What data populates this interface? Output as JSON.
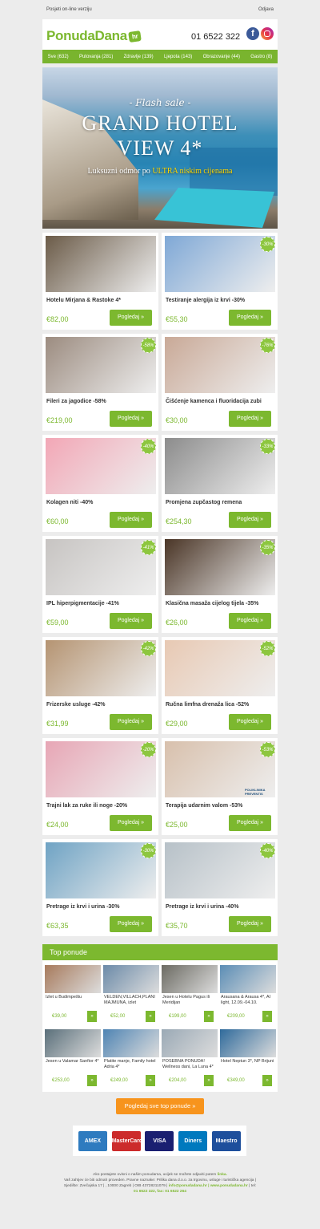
{
  "preheader": {
    "online": "Posjeti on-line verziju",
    "unsubscribe": "Odjava"
  },
  "header": {
    "logo": "PonudaDana",
    "logo_tld": "hr",
    "phone": "01 6522 322",
    "fb": "f"
  },
  "nav": [
    "Sve (632)",
    "Putovanja (281)",
    "Zdravlje (139)",
    "Ljepota (143)",
    "Obrazovanje (44)",
    "Gastro (8)"
  ],
  "hero": {
    "flash": "- Flash sale -",
    "line1": "GRAND HOTEL",
    "line2": "VIEW 4*",
    "tagline_prefix": "Luksuzni odmor po ",
    "tagline_highlight": "ULTRA niskim cijenama"
  },
  "products": [
    {
      "title": "Hotelu Mirjana & Rastoke 4*",
      "price": "€82,00",
      "button": "Pogledaj »",
      "badge": "",
      "img": "#6b5b48"
    },
    {
      "title": "Testiranje alergija iz krvi -30%",
      "price": "€55,30",
      "button": "Pogledaj »",
      "badge": "-30%",
      "img": "#7fa8d6"
    },
    {
      "title": "Fileri za jagodice -58%",
      "price": "€219,00",
      "button": "Pogledaj »",
      "badge": "-58%",
      "img": "#9c8c80"
    },
    {
      "title": "Čišćenje kamenca i fluoridacija zubi",
      "price": "€30,00",
      "button": "Pogledaj »",
      "badge": "-76%",
      "img": "#c9a997"
    },
    {
      "title": "Kolagen niti -40%",
      "price": "€60,00",
      "button": "Pogledaj »",
      "badge": "-40%",
      "img": "#f2a7b6"
    },
    {
      "title": "Promjena zupčastog remena",
      "price": "€254,30",
      "button": "Pogledaj »",
      "badge": "-33%",
      "img": "#8c8c8c"
    },
    {
      "title": "IPL hiperpigmentacije -41%",
      "price": "€59,00",
      "button": "Pogledaj »",
      "badge": "-41%",
      "img": "#c7c4c2"
    },
    {
      "title": "Klasična masaža cijelog tijela -35%",
      "price": "€26,00",
      "button": "Pogledaj »",
      "badge": "-35%",
      "img": "#4a3526"
    },
    {
      "title": "Frizerske usluge -42%",
      "price": "€31,99",
      "button": "Pogledaj »",
      "badge": "-42%",
      "img": "#b59472"
    },
    {
      "title": "Ručna limfna drenaža lica -52%",
      "price": "€29,00",
      "button": "Pogledaj »",
      "badge": "-52%",
      "img": "#e8c9b3"
    },
    {
      "title": "Trajni lak za ruke ili noge -20%",
      "price": "€24,00",
      "button": "Pogledaj »",
      "badge": "-20%",
      "img": "#e7a6b5"
    },
    {
      "title": "Terapija udarnim valom -53%",
      "price": "€25,00",
      "button": "Pogledaj »",
      "badge": "-53%",
      "img": "#d8c0ac"
    },
    {
      "title": "Pretrage iz krvi i urina -30%",
      "price": "€63,35",
      "button": "Pogledaj »",
      "badge": "-30%",
      "img": "#6fa3c4"
    },
    {
      "title": "Pretrage iz krvi i urina -40%",
      "price": "€35,70",
      "button": "Pogledaj »",
      "badge": "-40%",
      "img": "#b7c1c8"
    }
  ],
  "preventis_label": "POLIKLINIKA PREVENTIS",
  "top_title": "Top ponude",
  "top": [
    {
      "name": "Izlet u Budimpeštu",
      "price": "€39,00",
      "img": "#a77a5c"
    },
    {
      "name": "VELDEN,VILLACH,PLANI MAJMUNA, izlet",
      "price": "€52,00",
      "img": "#6b8aa8"
    },
    {
      "name": "Jesen u Hotelu Pagus ili Meridijan",
      "price": "€199,00",
      "img": "#6b6a62"
    },
    {
      "name": "Arausana & Arausa 4*, AI light, 12.09.-04.10.",
      "price": "€209,00",
      "img": "#5b8db5"
    },
    {
      "name": "Jesen u Valamar Sanfior 4*",
      "price": "€253,00",
      "img": "#5a6f7a"
    },
    {
      "name": "Platite manje, Family hotel Adria 4*",
      "price": "€249,00",
      "img": "#4f84b3"
    },
    {
      "name": "POSEBNA PONUDA! Wellness dani, La Luna 4*",
      "price": "€204,00",
      "img": "#9aa9b5"
    },
    {
      "name": "Hotel Neptun 3*, NP Brijuni",
      "price": "€349,00",
      "img": "#2f6a9b"
    }
  ],
  "mini_btn": "»",
  "cta": "Pogledaj sve top ponude »",
  "cards": [
    "AMEX",
    "MasterCard",
    "VISA",
    "Diners",
    "Maestro"
  ],
  "footer": {
    "l1a": "Ako postajete ovisni o našim ponudama, uvijek se možete odjaviti putem ",
    "l1b": "linka.",
    "l2": "Vaš zahtjev će biti odmah proveden. Pravne naznake: Prilika dana d.o.o. za trgovinu, usluge i turistička agencija |",
    "l3a": "Sjedište: Zvečajska 17 | , 10000 Zagreb | OIB 43728211079 | ",
    "l3b": "info@ponudadana.hr | www.ponudadana.hr",
    "l3c": " | tel:",
    "l4": "01 6522 322, fax: 01 6522 264"
  }
}
